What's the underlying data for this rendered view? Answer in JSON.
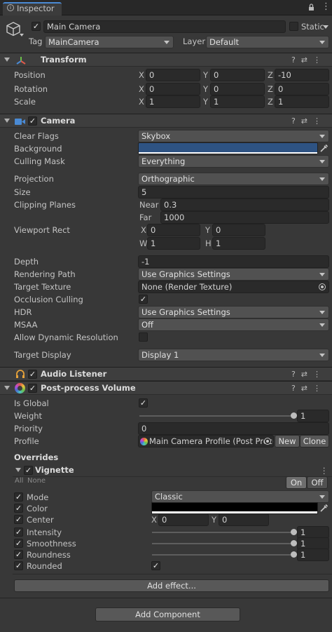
{
  "tab": {
    "label": "Inspector"
  },
  "gameobject": {
    "name": "Main Camera",
    "static_label": "Static",
    "tag_label": "Tag",
    "tag_value": "MainCamera",
    "layer_label": "Layer",
    "layer_value": "Default"
  },
  "transform": {
    "title": "Transform",
    "position_label": "Position",
    "rotation_label": "Rotation",
    "scale_label": "Scale",
    "position": {
      "x": "0",
      "y": "0",
      "z": "-10"
    },
    "rotation": {
      "x": "0",
      "y": "0",
      "z": "0"
    },
    "scale": {
      "x": "1",
      "y": "1",
      "z": "1"
    }
  },
  "axes": {
    "x": "X",
    "y": "Y",
    "z": "Z",
    "w": "W",
    "h": "H"
  },
  "camera": {
    "title": "Camera",
    "clear_flags_label": "Clear Flags",
    "clear_flags": "Skybox",
    "background_label": "Background",
    "background_color": "#2e5383",
    "culling_mask_label": "Culling Mask",
    "culling_mask": "Everything",
    "projection_label": "Projection",
    "projection": "Orthographic",
    "size_label": "Size",
    "size": "5",
    "clipping_label": "Clipping Planes",
    "near_label": "Near",
    "near": "0.3",
    "far_label": "Far",
    "far": "1000",
    "viewport_label": "Viewport Rect",
    "vp_x": "0",
    "vp_y": "0",
    "vp_w": "1",
    "vp_h": "1",
    "depth_label": "Depth",
    "depth": "-1",
    "rendering_path_label": "Rendering Path",
    "rendering_path": "Use Graphics Settings",
    "target_texture_label": "Target Texture",
    "target_texture": "None (Render Texture)",
    "occlusion_label": "Occlusion Culling",
    "hdr_label": "HDR",
    "hdr": "Use Graphics Settings",
    "msaa_label": "MSAA",
    "msaa": "Off",
    "dynres_label": "Allow Dynamic Resolution",
    "target_display_label": "Target Display",
    "target_display": "Display 1"
  },
  "audio": {
    "title": "Audio Listener"
  },
  "ppv": {
    "title": "Post-process Volume",
    "is_global_label": "Is Global",
    "weight_label": "Weight",
    "weight": "1",
    "weight_fraction": 1,
    "priority_label": "Priority",
    "priority": "0",
    "profile_label": "Profile",
    "profile": "Main Camera Profile (Post Proce",
    "new_label": "New",
    "clone_label": "Clone",
    "overrides_label": "Overrides"
  },
  "vignette": {
    "title": "Vignette",
    "all_label": "All",
    "none_label": "None",
    "on_label": "On",
    "off_label": "Off",
    "mode_label": "Mode",
    "mode": "Classic",
    "color_label": "Color",
    "color": "#000000",
    "center_label": "Center",
    "center_x": "0",
    "center_y": "0",
    "intensity_label": "Intensity",
    "intensity": "1",
    "intensity_fraction": 1,
    "smoothness_label": "Smoothness",
    "smoothness": "1",
    "smoothness_fraction": 1,
    "roundness_label": "Roundness",
    "roundness": "1",
    "roundness_fraction": 1,
    "rounded_label": "Rounded"
  },
  "footer": {
    "add_effect": "Add effect...",
    "add_component": "Add Component"
  },
  "icons": {
    "checkmark": "✓",
    "help": "?",
    "settings": "⇄",
    "menu": "⋮",
    "lock": "lock-icon"
  }
}
